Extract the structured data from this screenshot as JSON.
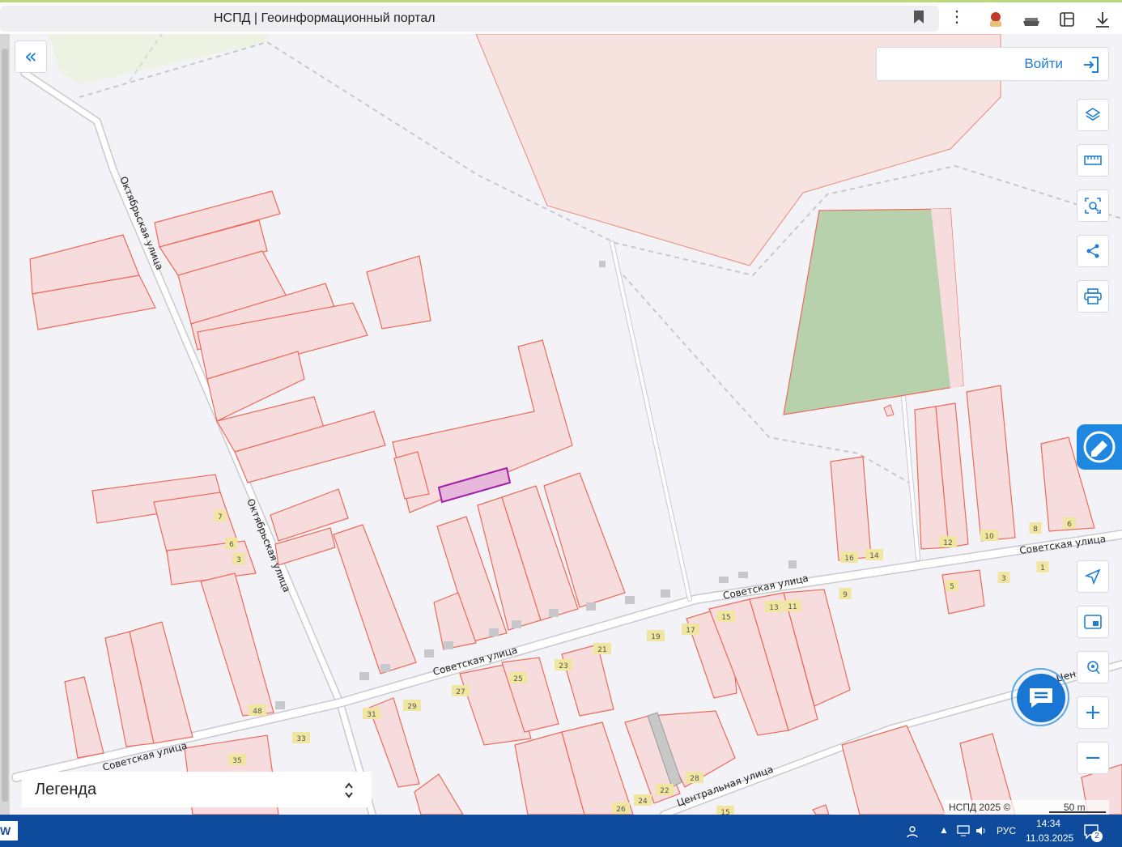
{
  "browser": {
    "tab_title": "НСПД | Геоинформационный портал"
  },
  "header": {
    "login_label": "Войти"
  },
  "controls": {
    "collapse": "«",
    "zoom_in": "+",
    "zoom_out": "−"
  },
  "legend": {
    "label": "Легенда"
  },
  "map": {
    "streets": {
      "oktyabrskaya_1": "Октябрьская улица",
      "oktyabrskaya_2": "Октябрьская улица",
      "sovetskaya_1": "Советская улица",
      "sovetskaya_2": "Советская улица",
      "sovetskaya_3": "Советская улица",
      "sovetskaya_4": "Советская улица",
      "tsentralnaya_1": "Центральная улица",
      "tsentralnaya_2": "Цен...ая"
    },
    "house_numbers": [
      "7",
      "6",
      "3",
      "48",
      "33",
      "35",
      "31",
      "29",
      "27",
      "25",
      "23",
      "21",
      "19",
      "17",
      "15",
      "13",
      "11",
      "9",
      "16",
      "14",
      "12",
      "10",
      "8",
      "6",
      "5",
      "3",
      "1",
      "28",
      "26",
      "24",
      "22",
      "15"
    ],
    "attribution": "НСПД 2025 ©",
    "scale": "50 m"
  },
  "taskbar": {
    "lang": "РУС",
    "time": "14:34",
    "date": "11.03.2025",
    "notif_count": "2"
  },
  "colors": {
    "parcel_fill": "#f6dcdc",
    "parcel_stroke": "#ec6a5a",
    "selected_fill": "#e8b7dc",
    "selected_stroke": "#a020a8",
    "green_parcel": "#bcd0b0",
    "accent": "#1f7ed6",
    "taskbar": "#0f4b9c"
  }
}
